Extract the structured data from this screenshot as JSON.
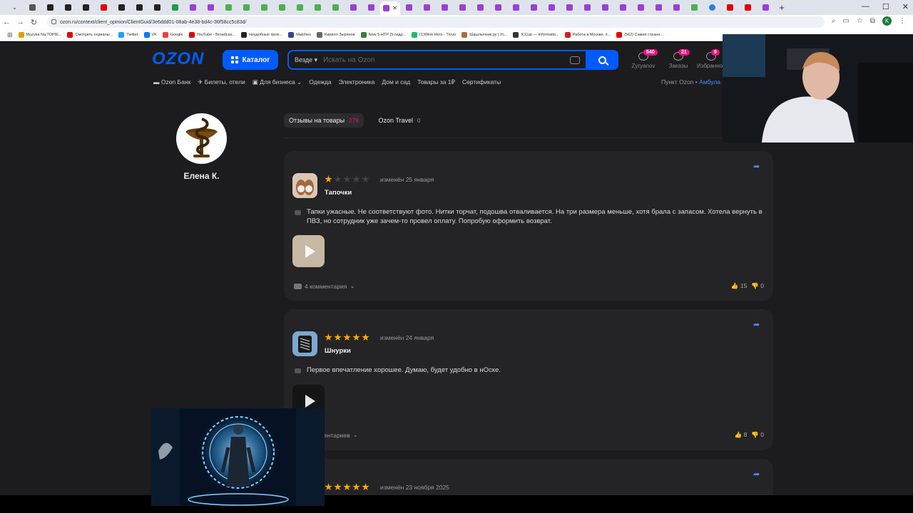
{
  "browser": {
    "url": "ozon.ru/context/client_opinion/ClientGuid/3e6ddd01-08ab-4e38-bd4c-36f58cc5c83d/",
    "profile_initial": "K",
    "bookmarks": [
      {
        "label": "Muzyka Na TOPIE...",
        "color": "#e0a000"
      },
      {
        "label": "Смотреть сериалы...",
        "color": "#e00000"
      },
      {
        "label": "Twitter",
        "color": "#1da1f2"
      },
      {
        "label": "VK",
        "color": "#0077ff"
      },
      {
        "label": "Google",
        "color": "#ea4335"
      },
      {
        "label": "YouTube - Broadcas...",
        "color": "#e00000"
      },
      {
        "label": "Неудобные прое...",
        "color": "#222222"
      },
      {
        "label": "Matches",
        "color": "#334488"
      },
      {
        "label": "Кирилл Зырянов",
        "color": "#666666"
      },
      {
        "label": "Now 5-HTP (5-гидр...",
        "color": "#3a7a3a"
      },
      {
        "label": "(1)Wink Hero - Trovo",
        "color": "#1bbf6a"
      },
      {
        "label": "Шашлычник.ру | Ус...",
        "color": "#a07040"
      },
      {
        "label": "ICCup — Informatio...",
        "color": "#333333"
      },
      {
        "label": "Работа в Москве, п...",
        "color": "#d02020"
      },
      {
        "label": "(562) Самая странн...",
        "color": "#e00000"
      }
    ]
  },
  "header": {
    "logo": "OZON",
    "catalog_label": "Каталог",
    "search_scope": "Везде",
    "search_placeholder": "Искать на Ozon",
    "icons": [
      {
        "label": "Zyryanov",
        "badge": "540"
      },
      {
        "label": "Заказы",
        "badge": "21"
      },
      {
        "label": "Избранное",
        "badge": "9"
      }
    ],
    "subnav": [
      "Ozon Банк",
      "Билеты, отели",
      "Для бизнеса",
      "Одежда",
      "Электроника",
      "Дом и сад",
      "Товары за 1₽",
      "Сертификаты"
    ],
    "pickup_label": "Пункт Ozon •",
    "pickup_value": "Амбула"
  },
  "profile": {
    "name": "Елена К."
  },
  "tabs": [
    {
      "label": "Отзывы на товары",
      "count": "279"
    },
    {
      "label": "Ozon Travel",
      "count": "0"
    }
  ],
  "reviews": [
    {
      "product": "Тапочки",
      "rating": 1,
      "date": "изменён 25 января",
      "text": "Тапки ужасные. Не соответствуют фото. Нитки торчат, подошва отваливается. На три размера меньше, хотя брала с запасом. Хотела вернуть в ПВЗ, но сотрудник уже зачем-то провел оплату. Попробую оформить возврат.",
      "comments": "4 комментария",
      "likes": "15",
      "dislikes": "0"
    },
    {
      "product": "Шнурки",
      "rating": 5,
      "date": "изменён 24 января",
      "text": "Первое впечатление хорошее. Думаю, будет удобно в нОске.",
      "comments": "ентариев",
      "likes": "8",
      "dislikes": "0"
    },
    {
      "product": "",
      "rating": 5,
      "date": "изменён 23 ноября 2025"
    }
  ]
}
